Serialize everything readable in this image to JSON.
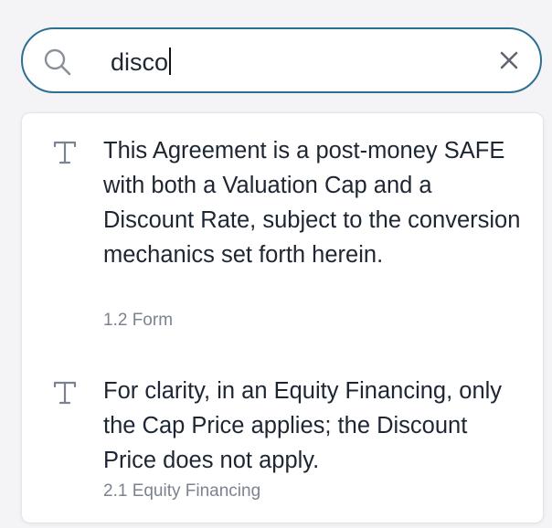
{
  "search": {
    "query": "disco",
    "icon": "search-icon",
    "clear_icon": "close-icon"
  },
  "results": [
    {
      "icon": "text-type-icon",
      "text": "This Agreement is a post-money SAFE with both a Valuation Cap and a Discount Rate, subject to the conversion mechanics set forth herein.",
      "section": "1.2 Form"
    },
    {
      "icon": "text-type-icon",
      "text": "For clarity, in an Equity Financing, only the Cap Price applies; the Discount Price does not apply.",
      "section": "2.1 Equity Financing"
    }
  ],
  "colors": {
    "search_border": "#2d6f93",
    "text": "#1e2633",
    "muted": "#7b8390",
    "icon": "#8a909a"
  }
}
